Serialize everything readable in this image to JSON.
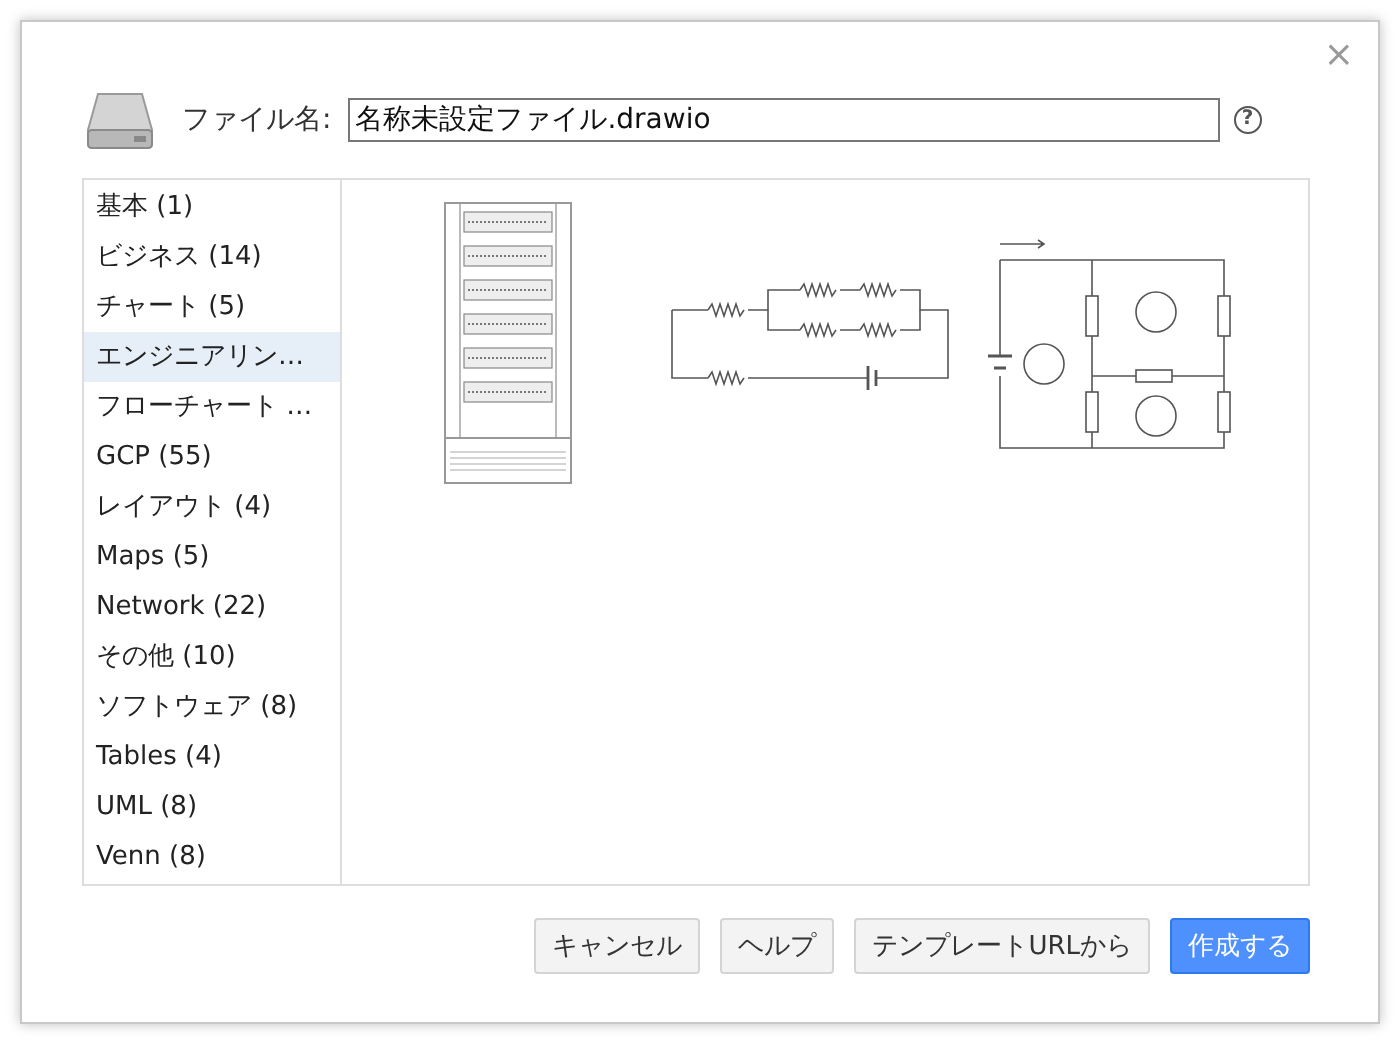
{
  "dialog": {
    "close": "×",
    "filename_label": "ファイル名:",
    "filename_value": "名称未設定ファイル.drawio",
    "help": "?"
  },
  "categories": [
    {
      "label": "基本 (1)",
      "selected": false
    },
    {
      "label": "ビジネス (14)",
      "selected": false
    },
    {
      "label": "チャート (5)",
      "selected": false
    },
    {
      "label": "エンジニアリン…",
      "selected": true
    },
    {
      "label": "フローチャート …",
      "selected": false
    },
    {
      "label": "GCP (55)",
      "selected": false
    },
    {
      "label": "レイアウト (4)",
      "selected": false
    },
    {
      "label": "Maps (5)",
      "selected": false
    },
    {
      "label": "Network (22)",
      "selected": false
    },
    {
      "label": "その他 (10)",
      "selected": false
    },
    {
      "label": "ソフトウェア (8)",
      "selected": false
    },
    {
      "label": "Tables (4)",
      "selected": false
    },
    {
      "label": "UML (8)",
      "selected": false
    },
    {
      "label": "Venn (8)",
      "selected": false
    }
  ],
  "templates": [
    {
      "kind": "cabinet"
    },
    {
      "kind": "resistor-network"
    },
    {
      "kind": "mesh-circuit"
    }
  ],
  "buttons": [
    {
      "label": "キャンセル",
      "kind": "plain"
    },
    {
      "label": "ヘルプ",
      "kind": "plain"
    },
    {
      "label": "テンプレートURLから",
      "kind": "plain"
    },
    {
      "label": "作成する",
      "kind": "primary"
    }
  ]
}
